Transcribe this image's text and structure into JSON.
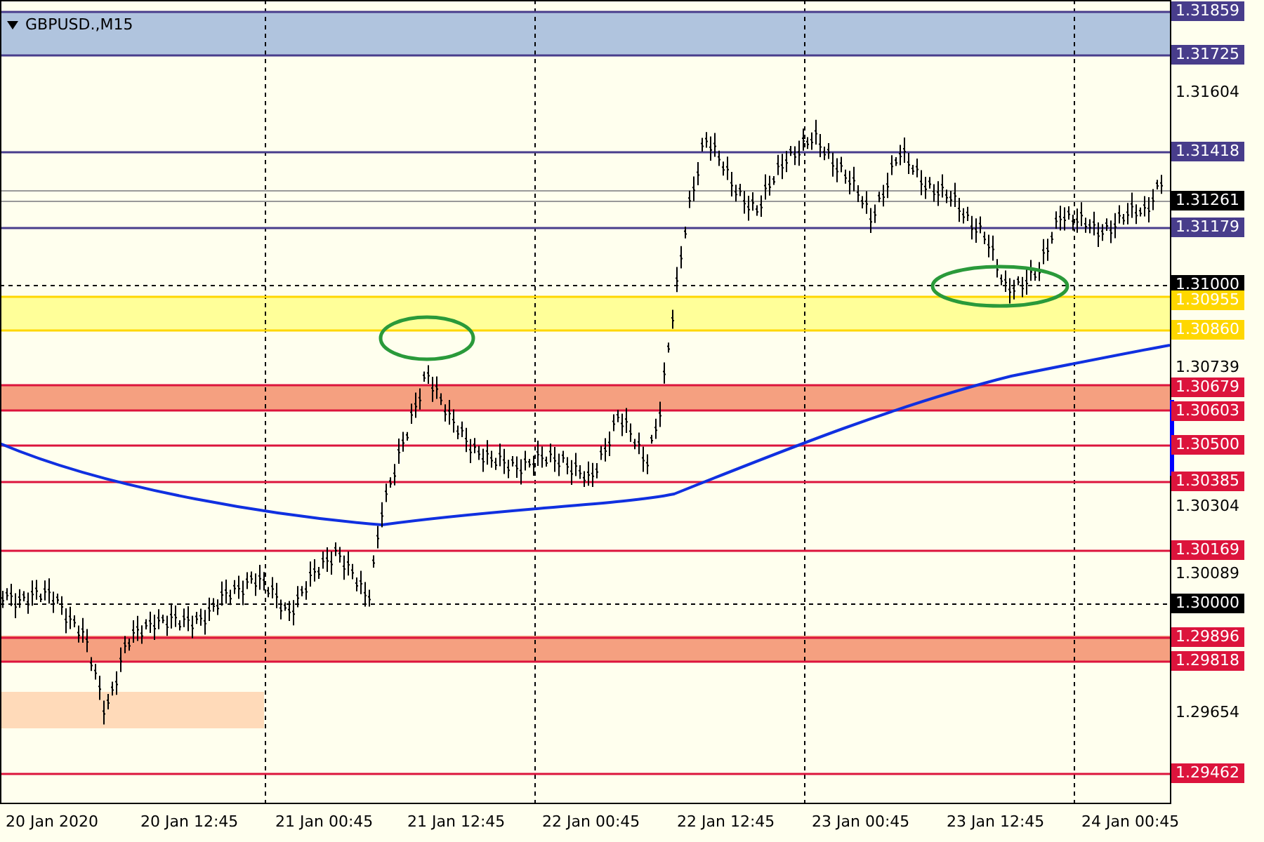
{
  "chart": {
    "symbol": "GBPUSD.,M15"
  },
  "price_axis": [
    {
      "text": "1.31859",
      "kind": "level",
      "color": "#483d8b"
    },
    {
      "text": "1.31725",
      "kind": "level",
      "color": "#483d8b"
    },
    {
      "text": "1.31604",
      "kind": "tick"
    },
    {
      "text": "1.31418",
      "kind": "level",
      "color": "#483d8b"
    },
    {
      "text": "1.31261",
      "kind": "marker",
      "color": "#000000"
    },
    {
      "text": "1.31179",
      "kind": "level",
      "color": "#483d8b"
    },
    {
      "text": "1.31000",
      "kind": "marker",
      "color": "#000000"
    },
    {
      "text": "1.30955",
      "kind": "level",
      "color": "#ffd700"
    },
    {
      "text": "1.30860",
      "kind": "level",
      "color": "#ffd700"
    },
    {
      "text": "1.30739",
      "kind": "tick"
    },
    {
      "text": "1.30679",
      "kind": "level",
      "color": "#dc143c"
    },
    {
      "text": "1.30603",
      "kind": "level",
      "color": "#dc143c"
    },
    {
      "text": "1.30500",
      "kind": "level",
      "color": "#dc143c"
    },
    {
      "text": "1.30385",
      "kind": "level",
      "color": "#dc143c"
    },
    {
      "text": "1.30304",
      "kind": "tick"
    },
    {
      "text": "1.30169",
      "kind": "level",
      "color": "#dc143c"
    },
    {
      "text": "1.30089",
      "kind": "tick"
    },
    {
      "text": "1.30000",
      "kind": "marker",
      "color": "#000000"
    },
    {
      "text": "1.29896",
      "kind": "level",
      "color": "#dc143c"
    },
    {
      "text": "1.29818",
      "kind": "level",
      "color": "#dc143c"
    },
    {
      "text": "1.29654",
      "kind": "tick"
    },
    {
      "text": "1.29462",
      "kind": "level",
      "color": "#dc143c"
    }
  ],
  "time_axis": [
    "20 Jan 2020",
    "20 Jan 12:45",
    "21 Jan 00:45",
    "21 Jan 12:45",
    "22 Jan 00:45",
    "22 Jan 12:45",
    "23 Jan 00:45",
    "23 Jan 12:45",
    "24 Jan 00:45"
  ]
}
